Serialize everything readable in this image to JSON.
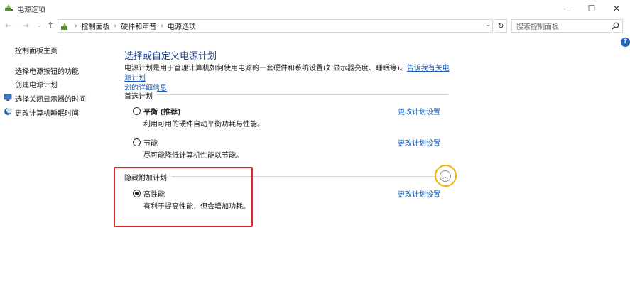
{
  "window": {
    "title": "电源选项",
    "minimize": "—",
    "maximize": "☐",
    "close": "✕"
  },
  "nav": {
    "back": "←",
    "forward": "→",
    "recent": "⌄",
    "up": "↑"
  },
  "address": {
    "crumbs": [
      "控制面板",
      "硬件和声音",
      "电源选项"
    ],
    "dropdown": "⌄",
    "refresh": "↻"
  },
  "search": {
    "placeholder": "搜索控制面板"
  },
  "help": "?",
  "sidebar": {
    "home": "控制面板主页",
    "items": [
      {
        "label": "选择电源按钮的功能",
        "icon": ""
      },
      {
        "label": "创建电源计划",
        "icon": ""
      },
      {
        "label": "选择关闭显示器的时间",
        "icon": "monitor-icon"
      },
      {
        "label": "更改计算机睡眠时间",
        "icon": "moon-icon"
      }
    ]
  },
  "main": {
    "title": "选择或自定义电源计划",
    "description_line1": "电源计划是用于管理计算机如何使用电源的一套硬件和系统设置(如显示器亮度、睡眠等)。",
    "description_link1": "告诉我有关电源计划",
    "description_link2": "划的详细信息",
    "preferred_section": "首选计划",
    "hidden_section": "隐藏附加计划",
    "plans": [
      {
        "name": "平衡 (推荐)",
        "desc": "利用可用的硬件自动平衡功耗与性能。",
        "link": "更改计划设置",
        "selected": false
      },
      {
        "name": "节能",
        "desc": "尽可能降低计算机性能以节能。",
        "link": "更改计划设置",
        "selected": false
      },
      {
        "name": "高性能",
        "desc": "有利于提高性能，但会增加功耗。",
        "link": "更改计划设置",
        "selected": true
      }
    ],
    "collapse": "︿"
  },
  "colors": {
    "highlight_box": "#d9262d",
    "collapse_ring": "#f0b400",
    "link": "#1a5fb4",
    "title": "#1c3d8c"
  }
}
